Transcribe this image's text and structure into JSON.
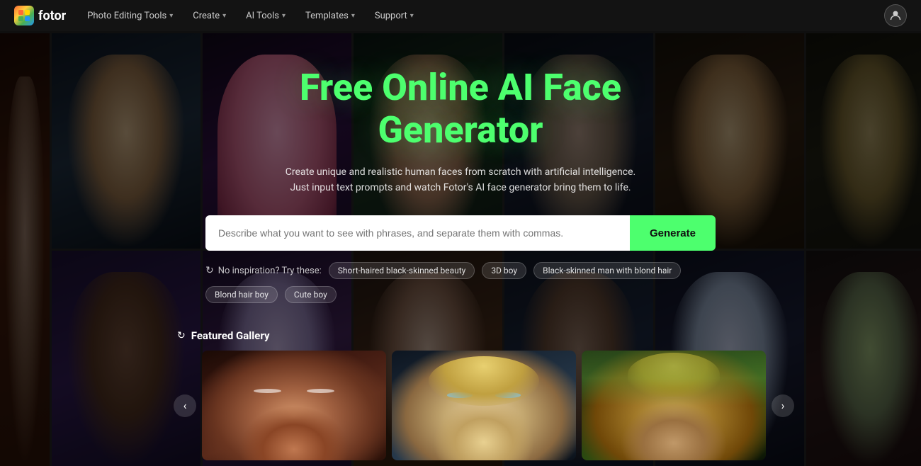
{
  "navbar": {
    "logo_text": "fotor",
    "nav_items": [
      {
        "label": "Photo Editing Tools",
        "has_chevron": true
      },
      {
        "label": "Create",
        "has_chevron": true
      },
      {
        "label": "AI Tools",
        "has_chevron": true
      },
      {
        "label": "Templates",
        "has_chevron": true
      },
      {
        "label": "Support",
        "has_chevron": true
      }
    ]
  },
  "hero": {
    "title": "Free Online AI Face Generator",
    "subtitle": "Create unique and realistic human faces from scratch with artificial intelligence. Just input text prompts and watch Fotor's AI face generator bring them to life.",
    "search_placeholder": "Describe what you want to see with phrases, and separate them with commas.",
    "generate_button": "Generate",
    "inspiration_label": "No inspiration? Try these:",
    "tags": [
      "Short-haired black-skinned beauty",
      "3D boy",
      "Black-skinned man with blond hair",
      "Blond hair boy",
      "Cute boy"
    ]
  },
  "gallery": {
    "title": "Featured Gallery",
    "cards": [
      {
        "id": 1,
        "style": "dark-woman"
      },
      {
        "id": 2,
        "style": "blonde-child"
      },
      {
        "id": 3,
        "style": "blonde-man"
      }
    ]
  },
  "icons": {
    "refresh": "↻",
    "arrow_left": "‹",
    "arrow_right": "›",
    "chevron_down": "▾"
  },
  "colors": {
    "accent_green": "#4dff6e",
    "nav_bg": "#161616",
    "tag_bg": "rgba(255,255,255,0.12)"
  }
}
